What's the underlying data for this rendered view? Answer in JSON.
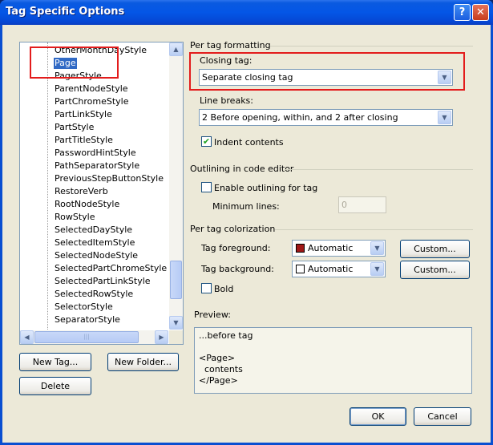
{
  "window": {
    "title": "Tag Specific Options",
    "help": "?",
    "close": "✕"
  },
  "tree": {
    "items": [
      "OtherMonthDayStyle",
      "Page",
      "PagerStyle",
      "ParentNodeStyle",
      "PartChromeStyle",
      "PartLinkStyle",
      "PartStyle",
      "PartTitleStyle",
      "PasswordHintStyle",
      "PathSeparatorStyle",
      "PreviousStepButtonStyle",
      "RestoreVerb",
      "RootNodeStyle",
      "RowStyle",
      "SelectedDayStyle",
      "SelectedItemStyle",
      "SelectedNodeStyle",
      "SelectedPartChromeStyle",
      "SelectedPartLinkStyle",
      "SelectedRowStyle",
      "SelectorStyle",
      "SeparatorStyle"
    ],
    "selected": "Page"
  },
  "buttons": {
    "new_tag": "New Tag...",
    "new_folder": "New Folder...",
    "delete": "Delete",
    "ok": "OK",
    "cancel": "Cancel",
    "custom_fg": "Custom...",
    "custom_bg": "Custom..."
  },
  "formatting": {
    "header": "Per tag formatting",
    "closing_label": "Closing tag:",
    "closing_value": "Separate closing tag",
    "line_breaks_label": "Line breaks:",
    "line_breaks_value": "2 Before opening, within, and 2 after closing",
    "indent_label": "Indent contents",
    "indent_checked": true
  },
  "outlining": {
    "header": "Outlining in code editor",
    "enable_label": "Enable outlining for tag",
    "enable_checked": false,
    "min_lines_label": "Minimum lines:",
    "min_lines_value": "0"
  },
  "colorization": {
    "header": "Per tag colorization",
    "fg_label": "Tag foreground:",
    "fg_value": "Automatic",
    "fg_color": "#a01818",
    "bg_label": "Tag background:",
    "bg_value": "Automatic",
    "bg_color": "#ffffff",
    "bold_label": "Bold",
    "bold_checked": false
  },
  "preview": {
    "label": "Preview:",
    "lines": [
      "...before tag",
      "",
      "<Page>",
      "  contents",
      "</Page>"
    ]
  }
}
